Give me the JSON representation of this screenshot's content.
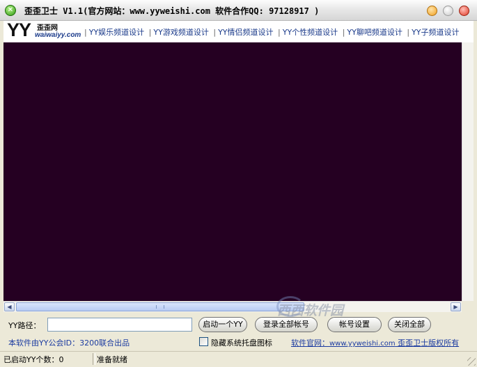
{
  "window": {
    "title": "歪歪卫士 V1.1(官方网站：www.yyweishi.com 软件合作QQ: 97128917 )"
  },
  "navbar": {
    "logo": {
      "mark": "YY",
      "name": "歪歪网",
      "url": "waiwaiyy.com"
    },
    "links": [
      "YY娱乐频道设计",
      "YY游戏频道设计",
      "YY情侣频道设计",
      "YY个性频道设计",
      "YY聊吧频道设计",
      "YY子频道设计"
    ]
  },
  "controls": {
    "path_label": "YY路径：",
    "path_value": "",
    "launch_button": "启动一个YY",
    "login_all_button": "登录全部帐号",
    "account_settings_button": "帐号设置",
    "close_all_button": "关闭全部",
    "credit": "本软件由YY公会ID：3200联合出品",
    "hide_tray_label": "隐藏系统托盘图标",
    "hide_tray_checked": false,
    "site_prefix": "软件官网：",
    "site_url": "www.yyweishi.com",
    "copyright": " 歪歪卫士版权所有"
  },
  "status": {
    "launched_count": "已启动YY个数：0",
    "ready": "准备就绪"
  },
  "watermark": "西西软件园",
  "colors": {
    "webview_bg": "#250022",
    "link": "#1a3aa0"
  }
}
